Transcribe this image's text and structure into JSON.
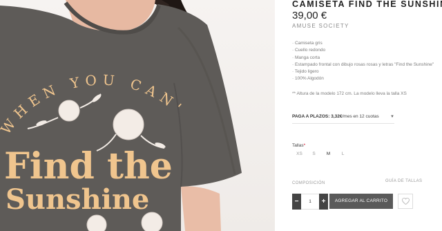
{
  "product": {
    "title": "CAMISETA FIND THE SUNSHINE",
    "price": "39,00 €",
    "brand": "AMUSE SOCIETY",
    "description": [
      "· Camiseta gris",
      "· Cuello redondo",
      "· Manga corta",
      "· Estampado frontal con dibujo rosas rosas y letras \"Find the Sunshine\"",
      "· Tejido ligero",
      "· 100% Algodón"
    ],
    "model_note": "** Altura de la modelo 172 cm. La modelo lleva la talla XS"
  },
  "photo": {
    "print_arc_text": "WHEN YOU CAN'T",
    "print_line1": "Find the",
    "print_line2": "Sunshine",
    "shirt_color": "#5e5b58",
    "print_color": "#f0c58e"
  },
  "installments": {
    "prefix": "PAGA A PLAZOS:",
    "amount": "3,32€",
    "suffix": "/mes en 12 cuotas"
  },
  "sizes": {
    "label": "Tallas",
    "required_mark": "*",
    "options": [
      "XS",
      "S",
      "M",
      "L"
    ],
    "selected": "M"
  },
  "composition_label": "COMPOSICIÓN",
  "size_guide_label": "GUÍA DE TALLAS",
  "cart": {
    "minus": "−",
    "quantity": "1",
    "plus": "+",
    "add_label": "AGREGAR AL CARRITO",
    "wishlist_icon": "heart-icon",
    "button_color": "#5a5a5a"
  }
}
